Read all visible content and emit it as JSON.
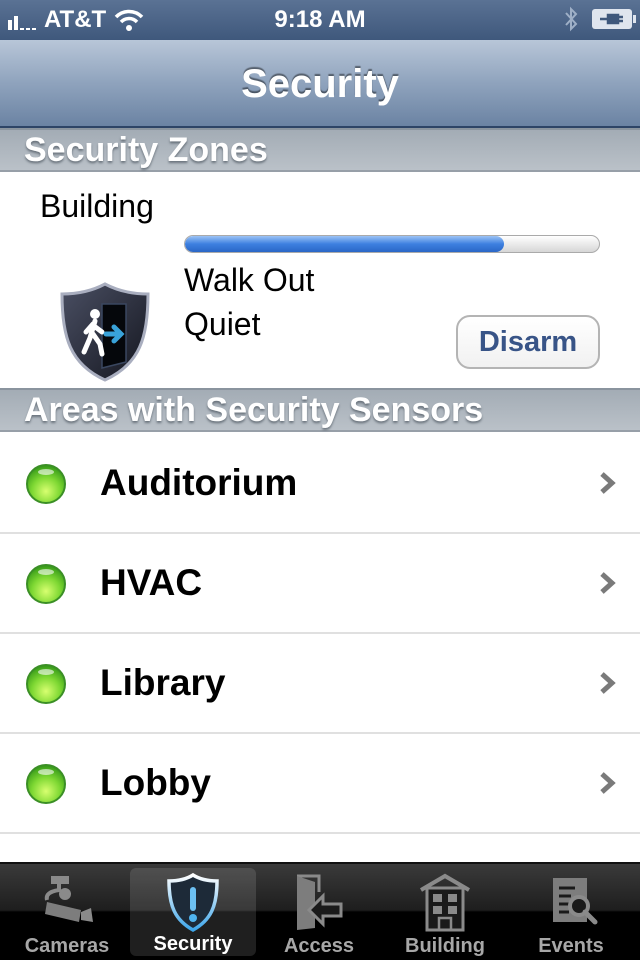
{
  "status_bar": {
    "carrier": "AT&T",
    "time": "9:18 AM",
    "signal_bars": 2,
    "wifi": true,
    "bluetooth": true,
    "battery": "charging"
  },
  "nav": {
    "title": "Security"
  },
  "zones_section": {
    "header": "Security Zones",
    "zone": {
      "name": "Building",
      "progress": 0.77,
      "mode": "Walk Out",
      "state": "Quiet",
      "icon": "shield-walk-out-icon",
      "action_label": "Disarm"
    }
  },
  "areas_section": {
    "header": "Areas with Security Sensors",
    "items": [
      {
        "name": "Auditorium",
        "status": "ok",
        "status_color": "#6fd02c"
      },
      {
        "name": "HVAC",
        "status": "ok",
        "status_color": "#6fd02c"
      },
      {
        "name": "Library",
        "status": "ok",
        "status_color": "#6fd02c"
      },
      {
        "name": "Lobby",
        "status": "ok",
        "status_color": "#6fd02c"
      }
    ]
  },
  "tab_bar": {
    "active": "Security",
    "tabs": [
      {
        "label": "Cameras",
        "icon": "camera-icon"
      },
      {
        "label": "Security",
        "icon": "shield-alert-icon"
      },
      {
        "label": "Access",
        "icon": "door-enter-icon"
      },
      {
        "label": "Building",
        "icon": "building-icon"
      },
      {
        "label": "Events",
        "icon": "event-log-icon"
      }
    ]
  },
  "colors": {
    "nav_accent": "#6b83a3",
    "progress_fill": "#3d80e0",
    "button_text": "#385487",
    "active_tab_icon": "#4fb4f0"
  }
}
